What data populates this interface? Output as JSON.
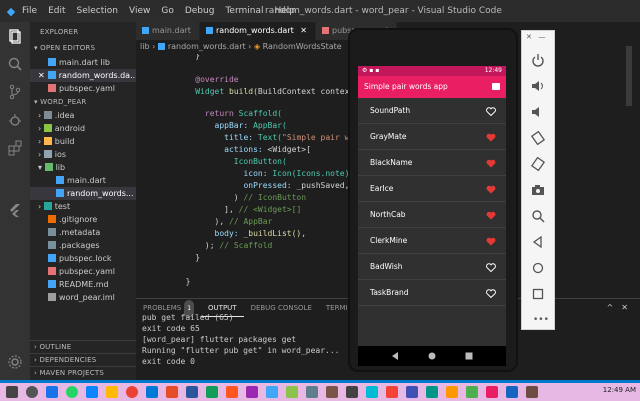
{
  "window": {
    "title": "random_words.dart - word_pear - Visual Studio Code",
    "menu": [
      "File",
      "Edit",
      "Selection",
      "View",
      "Go",
      "Debug",
      "Terminal",
      "Help"
    ]
  },
  "sidebar": {
    "explorer_title": "EXPLORER",
    "open_editors_title": "OPEN EDITORS",
    "open_editors": [
      "main.dart lib",
      "random_words.da...",
      "pubspec.yaml"
    ],
    "project_title": "WORD_PEAR",
    "tree": [
      ".idea",
      "android",
      "build",
      "ios",
      "lib",
      "main.dart",
      "random_words...",
      "test",
      ".gitignore",
      ".metadata",
      ".packages",
      "pubspec.lock",
      "pubspec.yaml",
      "README.md",
      "word_pear.iml"
    ],
    "outline": "OUTLINE",
    "dependencies": "DEPENDENCIES",
    "maven": "MAVEN PROJECTS"
  },
  "editor": {
    "tabs": [
      "main.dart",
      "random_words.dart",
      "pubspec.yaml"
    ],
    "breadcrumb": [
      "lib",
      "random_words.dart",
      "RandomWordsState"
    ],
    "line_numbers": [
      "3",
      "",
      "",
      "",
      "",
      "",
      "",
      "",
      "",
      "",
      "",
      "",
      "",
      "",
      "",
      "",
      ""
    ],
    "code": {
      "brace_top": "}",
      "annotation": "@override",
      "build_sig_type": "Widget",
      "build_sig_name": "build",
      "build_sig_rest": "(BuildContext context) {",
      "return_kw": "return",
      "scaffold": "Scaffold(",
      "appbar_prop": "appBar:",
      "appbar_ctor": "AppBar(",
      "title_prop": "title:",
      "text_ctor": "Text(",
      "title_str": "\"Simple pair words",
      "actions_prop": "actions:",
      "actions_val": "<Widget>[",
      "iconbutton": "IconButton(",
      "icon_prop": "icon:",
      "icon_val": "Icon(Icons.note),",
      "onpressed_prop": "onPressed:",
      "onpressed_val": "_pushSaved,",
      "close_iconbutton": ")",
      "cm_iconbutton": "// IconButton",
      "close_list": "],",
      "cm_widget": "// <Widget>[]",
      "close_appbar": "),",
      "cm_appbar": "// AppBar",
      "body_prop": "body:",
      "body_val": "_buildList(),",
      "close_scaffold": ");",
      "cm_scaffold": "// Scaffold",
      "close_build": "}",
      "close_class": "}"
    }
  },
  "panel": {
    "tabs": [
      "PROBLEMS",
      "OUTPUT",
      "DEBUG CONSOLE",
      "TERMINAL"
    ],
    "problems_count": "1",
    "terminal_lines": [
      "pub get failed (65)",
      "exit code 65",
      "[word_pear] flutter packages get",
      "Running \"flutter pub get\" in word_pear...",
      "exit code 0"
    ]
  },
  "phone": {
    "time": "12:49",
    "app_title": "Simple pair words app",
    "items": [
      {
        "word": "SoundPath",
        "saved": false
      },
      {
        "word": "GrayMate",
        "saved": true
      },
      {
        "word": "BlackName",
        "saved": true
      },
      {
        "word": "EarIce",
        "saved": true
      },
      {
        "word": "NorthCab",
        "saved": true
      },
      {
        "word": "ClerkMine",
        "saved": true
      },
      {
        "word": "BadWish",
        "saved": false
      },
      {
        "word": "TaskBrand",
        "saved": false
      }
    ]
  },
  "taskbar": {
    "clock": "12:49 AM"
  },
  "colors": {
    "accent": "#e91e63",
    "heart_saved": "#e53935",
    "vscode_blue": "#007acc"
  }
}
